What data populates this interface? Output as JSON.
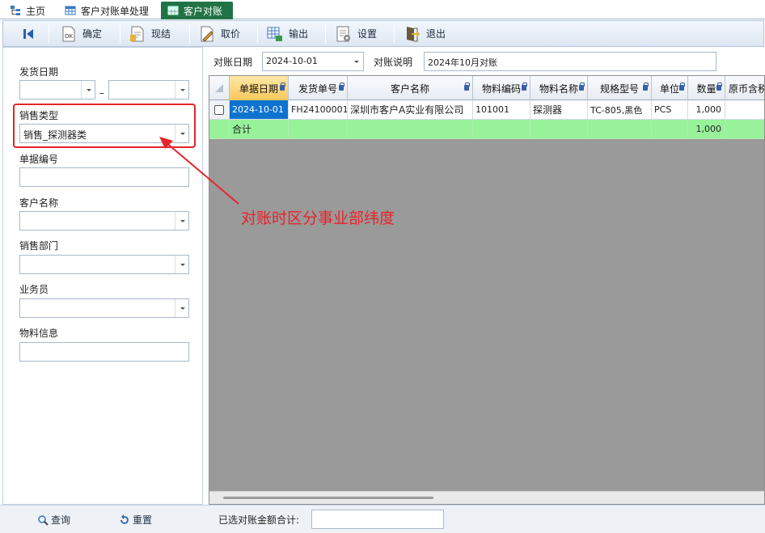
{
  "tabs": [
    {
      "label": "主页",
      "icon": "home-tree-icon"
    },
    {
      "label": "客户对账单处理",
      "icon": "grid-icon"
    },
    {
      "label": "客户对账",
      "icon": "grid-icon"
    }
  ],
  "toolbar": {
    "confirm": "确定",
    "settle": "现结",
    "cancel_price": "取价",
    "export": "输出",
    "settings": "设置",
    "exit": "退出"
  },
  "filters": {
    "ship_date_label": "发货日期",
    "date_separator": "–",
    "sales_type_label": "销售类型",
    "sales_type_value": "销售_探测器类",
    "doc_no_label": "单据编号",
    "customer_label": "客户名称",
    "dept_label": "销售部门",
    "salesman_label": "业务员",
    "material_label": "物料信息"
  },
  "header_fields": {
    "date_label": "对账日期",
    "date_value": "2024-10-01",
    "desc_label": "对账说明",
    "desc_value": "2024年10月对账"
  },
  "grid": {
    "columns": [
      "单据日期",
      "发货单号",
      "客户名称",
      "物料编码",
      "物料名称",
      "规格型号",
      "单位",
      "数量",
      "原币含税"
    ],
    "rows": [
      {
        "date": "2024-10-01",
        "ship_no": "FH24100001",
        "customer": "深圳市客户A实业有限公司",
        "mat_code": "101001",
        "mat_name": "探测器",
        "spec": "TC-805,黑色",
        "unit": "PCS",
        "qty": "1,000"
      }
    ],
    "total": {
      "label": "合计",
      "qty": "1,000"
    }
  },
  "annotation": "对账时区分事业部纬度",
  "bottom": {
    "query": "查询",
    "reset": "重置",
    "selected_total_label": "已选对账金额合计:"
  },
  "colors": {
    "accent_tab": "#217346",
    "highlight": "#e5242b",
    "total_row": "#98f29a",
    "focus_cell": "#0d73cf"
  }
}
